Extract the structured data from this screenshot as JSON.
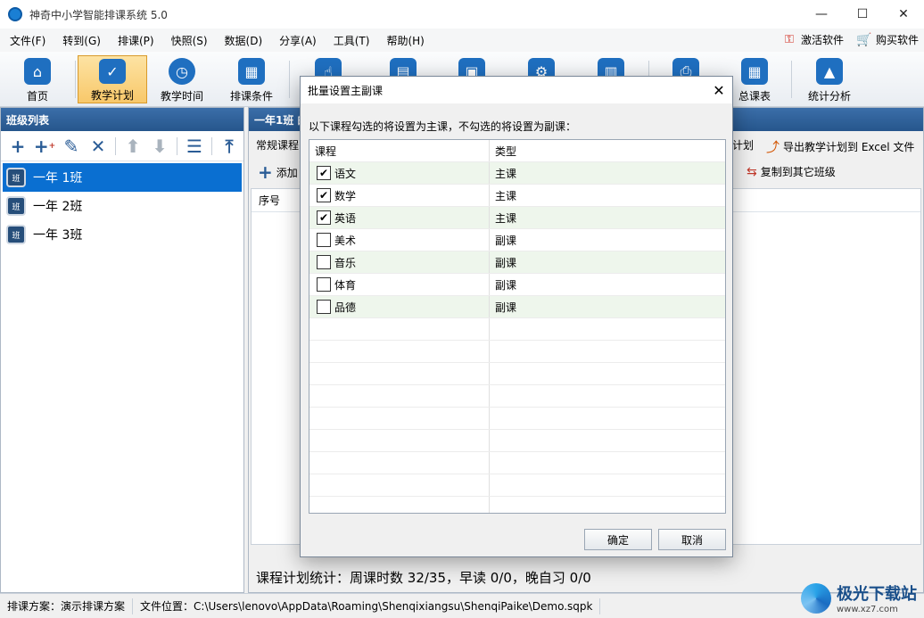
{
  "window": {
    "title": "神奇中小学智能排课系统 5.0",
    "controls": {
      "minimize": "—",
      "maximize": "☐",
      "close": "✕"
    }
  },
  "menu": {
    "items": [
      "文件(F)",
      "转到(G)",
      "排课(P)",
      "快照(S)",
      "数据(D)",
      "分享(A)",
      "工具(T)",
      "帮助(H)"
    ],
    "activate": "激活软件",
    "buy": "购买软件"
  },
  "toolbar": {
    "buttons": [
      {
        "label": "首页",
        "icon": "home-icon"
      },
      {
        "label": "教学计划",
        "icon": "clipboard-icon",
        "active": true
      },
      {
        "label": "教学时间",
        "icon": "clock-icon"
      },
      {
        "label": "排课条件",
        "icon": "cubes-icon"
      },
      {
        "label": "",
        "icon": "hand-icon"
      },
      {
        "label": "",
        "icon": "calendar-icon"
      },
      {
        "label": "",
        "icon": "badge-icon"
      },
      {
        "label": "",
        "icon": "tool-icon"
      },
      {
        "label": "",
        "icon": "document-icon"
      },
      {
        "label": "",
        "icon": "printer-icon"
      },
      {
        "label": "总课表",
        "icon": "schedule-icon"
      },
      {
        "label": "统计分析",
        "icon": "chart-icon"
      }
    ]
  },
  "left_panel": {
    "header": "班级列表",
    "classes": [
      {
        "name": "一年 1班",
        "icon_text": "班",
        "selected": true
      },
      {
        "name": "一年 2班",
        "icon_text": "班"
      },
      {
        "name": "一年 3班",
        "icon_text": "班"
      }
    ]
  },
  "right_panel": {
    "header": "一年1班 的",
    "tab": "常规课程",
    "action_plan": "计划",
    "export": "导出教学计划到 Excel 文件",
    "add": "添加",
    "copy": "复制到其它班级",
    "col_index": "序号",
    "stats": "课程计划统计：周课时数 32/35，早读 0/0，晚自习 0/0"
  },
  "status": {
    "plan": "排课方案：演示排课方案",
    "file": "文件位置：C:\\Users\\lenovo\\AppData\\Roaming\\Shenqixiangsu\\ShenqiPaike\\Demo.sqpk"
  },
  "watermark": {
    "name": "极光下载站",
    "url": "www.xz7.com"
  },
  "dialog": {
    "title": "批量设置主副课",
    "description": "以下课程勾选的将设置为主课，不勾选的将设置为副课：",
    "headers": {
      "course": "课程",
      "type": "类型"
    },
    "rows": [
      {
        "course": "语文",
        "type": "主课",
        "checked": true
      },
      {
        "course": "数学",
        "type": "主课",
        "checked": true
      },
      {
        "course": "英语",
        "type": "主课",
        "checked": true
      },
      {
        "course": "美术",
        "type": "副课",
        "checked": false
      },
      {
        "course": "音乐",
        "type": "副课",
        "checked": false
      },
      {
        "course": "体育",
        "type": "副课",
        "checked": false
      },
      {
        "course": "品德",
        "type": "副课",
        "checked": false
      }
    ],
    "ok": "确定",
    "cancel": "取消"
  }
}
